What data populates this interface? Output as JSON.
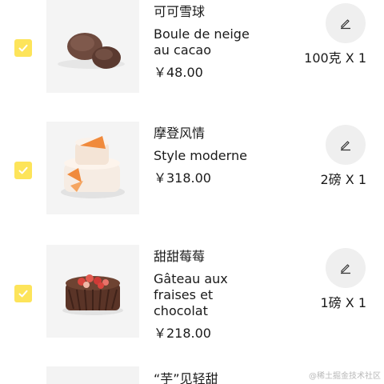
{
  "items": [
    {
      "name_cn": "可可雪球",
      "name_fr": "Boule de neige au cacao",
      "price": "￥48.00",
      "qty": "100克 X 1",
      "image": "cocoa-snowball-photo",
      "checked": true
    },
    {
      "name_cn": "摩登风情",
      "name_fr": "Style moderne",
      "price": "￥318.00",
      "qty": "2磅 X 1",
      "image": "orange-layer-cake-photo",
      "checked": true
    },
    {
      "name_cn": "甜甜莓莓",
      "name_fr": "Gâteau aux fraises et chocolat",
      "price": "￥218.00",
      "qty": "1磅 X 1",
      "image": "chocolate-strawberry-cake-photo",
      "checked": true
    },
    {
      "name_cn": "“芋”见轻甜"
    }
  ],
  "watermark": "@稀土掘金技术社区",
  "colors": {
    "checkbox": "#fde45a",
    "edit_bg": "#efefef",
    "thumb_bg": "#f3f3f3"
  }
}
